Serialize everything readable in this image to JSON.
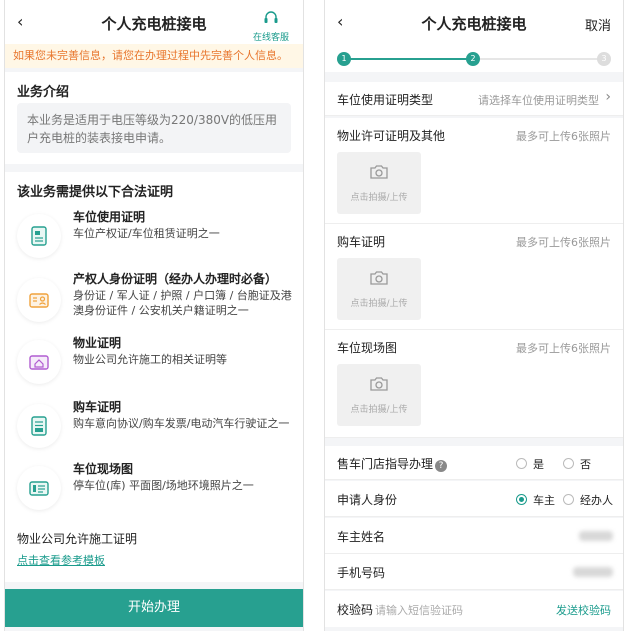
{
  "left": {
    "title": "个人充电桩接电",
    "back": "‹",
    "service_label": "在线客服",
    "notice": "如果您未完善信息，请您在办理过程中先完善个人信息。",
    "intro_title": "业务介绍",
    "intro_text": "本业务是适用于电压等级为220/380V的低压用户充电桩的装表接电申请。",
    "proof_title": "该业务需提供以下合法证明",
    "requirements": [
      {
        "title": "车位使用证明",
        "desc": "车位产权证/车位租赁证明之一",
        "icon": "document-icon"
      },
      {
        "title": "产权人身份证明（经办人办理时必备）",
        "desc": "身份证 / 军人证 / 护照 / 户口簿 / 台胞证及港澳身份证件 / 公安机关户籍证明之一",
        "icon": "id-card-icon"
      },
      {
        "title": "物业证明",
        "desc": "物业公司允许施工的相关证明等",
        "icon": "house-icon"
      },
      {
        "title": "购车证明",
        "desc": "购车意向协议/购车发票/电动汽车行驶证之一",
        "icon": "receipt-icon"
      },
      {
        "title": "车位现场图",
        "desc": "停车位(库) 平面图/场地环境照片之一",
        "icon": "site-plan-icon"
      }
    ],
    "property_permit": "物业公司允许施工证明",
    "template_link": "点击查看参考模板",
    "start_button": "开始办理"
  },
  "right": {
    "title": "个人充电桩接电",
    "back": "‹",
    "cancel": "取消",
    "steps": [
      "1",
      "2",
      "3"
    ],
    "current_step": 2,
    "parking_proof_type_label": "车位使用证明类型",
    "parking_proof_type_placeholder": "请选择车位使用证明类型",
    "upload_sections": [
      {
        "label": "物业许可证明及其他",
        "hint": "最多可上传6张照片",
        "upload_text": "点击拍摄/上传"
      },
      {
        "label": "购车证明",
        "hint": "最多可上传6张照片",
        "upload_text": "点击拍摄/上传"
      },
      {
        "label": "车位现场图",
        "hint": "最多可上传6张照片",
        "upload_text": "点击拍摄/上传"
      }
    ],
    "dealer_guide_label": "售车门店指导办理",
    "dealer_guide_options": [
      "是",
      "否"
    ],
    "applicant_label": "申请人身份",
    "applicant_options": [
      "车主",
      "经办人"
    ],
    "applicant_selected": "车主",
    "owner_name_label": "车主姓名",
    "phone_label": "手机号码",
    "code_label": "校验码",
    "code_placeholder": "请输入短信验证码",
    "send_code": "发送校验码"
  },
  "colors": {
    "accent": "#1a9b8c",
    "button": "#27a090",
    "notice_text": "#e8762d",
    "notice_bg": "#fff7e6"
  }
}
